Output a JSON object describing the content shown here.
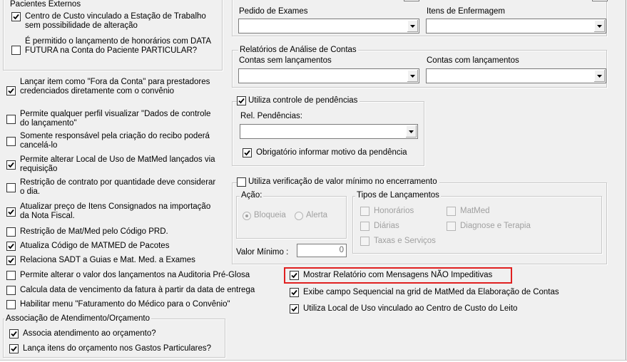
{
  "left": {
    "group_pacientes": {
      "title": "Pacientes Externos",
      "cb_centro_custo": {
        "label": "Centro de Custo vinculado a Estação de Trabalho sem possibilidade de alteração",
        "checked": true
      },
      "cb_data_futura": {
        "label": "É permitido o lançamento de honorários com DATA FUTURA na Conta do Paciente PARTICULAR?",
        "checked": false
      }
    },
    "options": [
      {
        "label": "Lançar item como \"Fora da Conta\" para prestadores credenciados diretamente com o convênio",
        "checked": true
      },
      {
        "label": "Permite qualquer perfil visualizar \"Dados de controle do lançamento\"",
        "checked": false
      },
      {
        "label": "Somente responsável pela criação do recibo poderá cancelá-lo",
        "checked": false
      },
      {
        "label": "Permite alterar Local de Uso de MatMed lançados via requisição",
        "checked": true
      },
      {
        "label": "Restrição de contrato por quantidade deve considerar o dia.",
        "checked": false
      },
      {
        "label": "Atualizar preço de Itens Consignados na importação da Nota Fiscal.",
        "checked": true
      },
      {
        "label": "Restrição de Mat/Med pelo Código PRD.",
        "checked": false
      },
      {
        "label": "Atualiza Código de MATMED de Pacotes",
        "checked": true
      },
      {
        "label": "Relaciona SADT a Guias e Mat. Med. a Exames",
        "checked": true
      },
      {
        "label": "Permite alterar o valor dos lançamentos na Auditoria Pré-Glosa",
        "checked": false
      },
      {
        "label": "Calcula data de vencimento da fatura à partir da data de entrega",
        "checked": false
      },
      {
        "label": "Habilitar menu \"Faturamento do Médico para o Convênio\"",
        "checked": false
      }
    ],
    "group_orcamento": {
      "title": "Associação de Atendimento/Orçamento",
      "cb_associa": {
        "label": "Associa atendimento ao orçamento?",
        "checked": true
      },
      "cb_lanca": {
        "label": "Lança itens do orçamento nos Gastos Particulares?",
        "checked": true
      }
    }
  },
  "right": {
    "pedido_exames": {
      "label": "Pedido de Exames",
      "value": ""
    },
    "itens_enfermagem": {
      "label": "Itens de Enfermagem",
      "value": ""
    },
    "group_relatorios": {
      "title": "Relatórios de Análise de Contas",
      "contas_sem": {
        "label": "Contas sem lançamentos",
        "value": ""
      },
      "contas_com": {
        "label": "Contas com lançamentos",
        "value": ""
      }
    },
    "group_pendencias": {
      "title": "Utiliza controle de pendências",
      "checked": true,
      "rel_label": "Rel. Pendências:",
      "rel_value": "",
      "cb_motivo": {
        "label": "Obrigatório informar motivo da pendência",
        "checked": true
      }
    },
    "group_valor_minimo": {
      "title": "Utiliza verificação de valor mínimo no encerramento",
      "checked": false,
      "acao": {
        "title": "Ação:",
        "bloqueia": "Bloqueia",
        "alerta": "Alerta",
        "selected": "Bloqueia"
      },
      "tipos": {
        "title": "Tipos de Lançamentos",
        "honorarios": "Honorários",
        "matmed": "MatMed",
        "diarias": "Diárias",
        "diagnose": "Diagnose e Terapia",
        "taxas": "Taxas e Serviços"
      },
      "valor_label": "Valor Mínimo :",
      "valor_value": "0"
    },
    "cb_mostrar_relatorio": {
      "label": "Mostrar Relatório com Mensagens NÃO Impeditivas",
      "checked": true
    },
    "cb_exibe_sequencial": {
      "label": "Exibe campo Sequencial na grid de MatMed da Elaboração de Contas",
      "checked": true
    },
    "cb_local_uso": {
      "label": "Utiliza Local de Uso vinculado ao Centro de Custo do Leito",
      "checked": true
    }
  },
  "colors": {
    "background": "#f0f0f0",
    "highlight": "#e02020"
  }
}
